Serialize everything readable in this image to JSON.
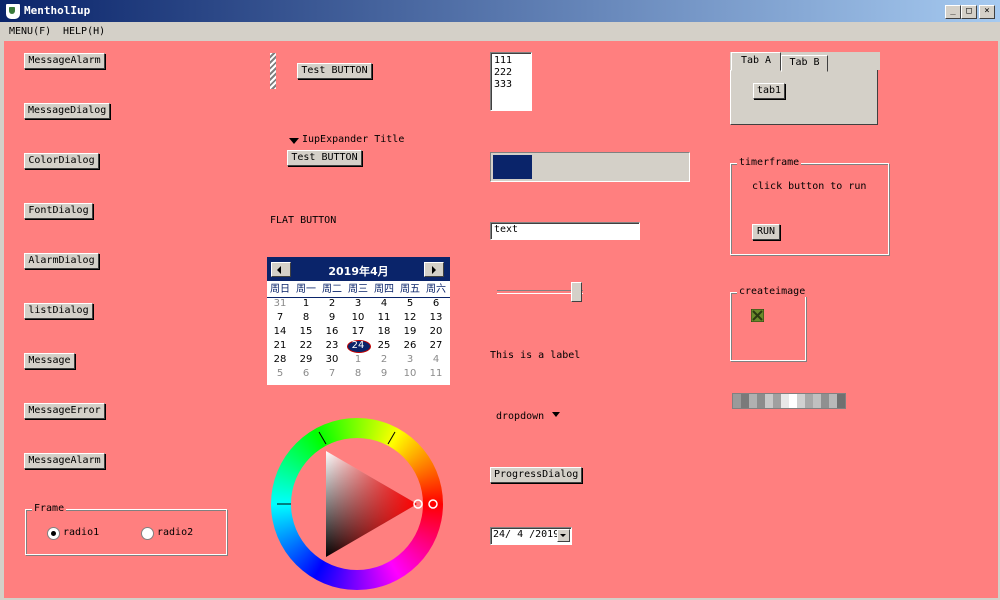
{
  "window": {
    "title": "MentholIup",
    "buttons": {
      "minimize": "_",
      "maximize": "□",
      "close": "×"
    }
  },
  "menu": [
    "MENU(F)",
    "HELP(H)"
  ],
  "left_buttons": [
    "MessageAlarm",
    "MessageDialog",
    "ColorDialog",
    "FontDialog",
    "AlarmDialog",
    "listDialog",
    "Message",
    "MessageError",
    "MessageAlarm"
  ],
  "frame": {
    "title": "Frame",
    "radio1": "radio1",
    "radio2": "radio2",
    "selected": "radio1"
  },
  "col2": {
    "test_button": "Test BUTTON",
    "expander_title": "IupExpander Title",
    "expander_button": "Test BUTTON",
    "flat_button": "FLAT BUTTON"
  },
  "calendar": {
    "month_title": "2019年4月",
    "weekdays": [
      "周日",
      "周一",
      "周二",
      "周三",
      "周四",
      "周五",
      "周六"
    ],
    "weeks": [
      [
        "31",
        "1",
        "2",
        "3",
        "4",
        "5",
        "6"
      ],
      [
        "7",
        "8",
        "9",
        "10",
        "11",
        "12",
        "13"
      ],
      [
        "14",
        "15",
        "16",
        "17",
        "18",
        "19",
        "20"
      ],
      [
        "21",
        "22",
        "23",
        "24",
        "25",
        "26",
        "27"
      ],
      [
        "28",
        "29",
        "30",
        "1",
        "2",
        "3",
        "4"
      ],
      [
        "5",
        "6",
        "7",
        "8",
        "9",
        "10",
        "11"
      ]
    ],
    "today": "24"
  },
  "col3": {
    "list_items": [
      "111",
      "222",
      "333"
    ],
    "progress_fraction": 0.2,
    "text_value": "text",
    "slider_fraction": 0.9,
    "label": "This is a label",
    "dropdown": "dropdown",
    "progress_dialog_button": "ProgressDialog",
    "date_value": "24/ 4 /2019"
  },
  "col4": {
    "tab_a": "Tab A",
    "tab_b": "Tab B",
    "tab_button": "tab1",
    "timer_frame_title": "timerframe",
    "timer_text": "click button to run",
    "run_button": "RUN",
    "createimage_title": "createimage"
  },
  "colors": {
    "background": "#ff7f7f",
    "face": "#d4d0c8",
    "accent": "#0a246a"
  }
}
